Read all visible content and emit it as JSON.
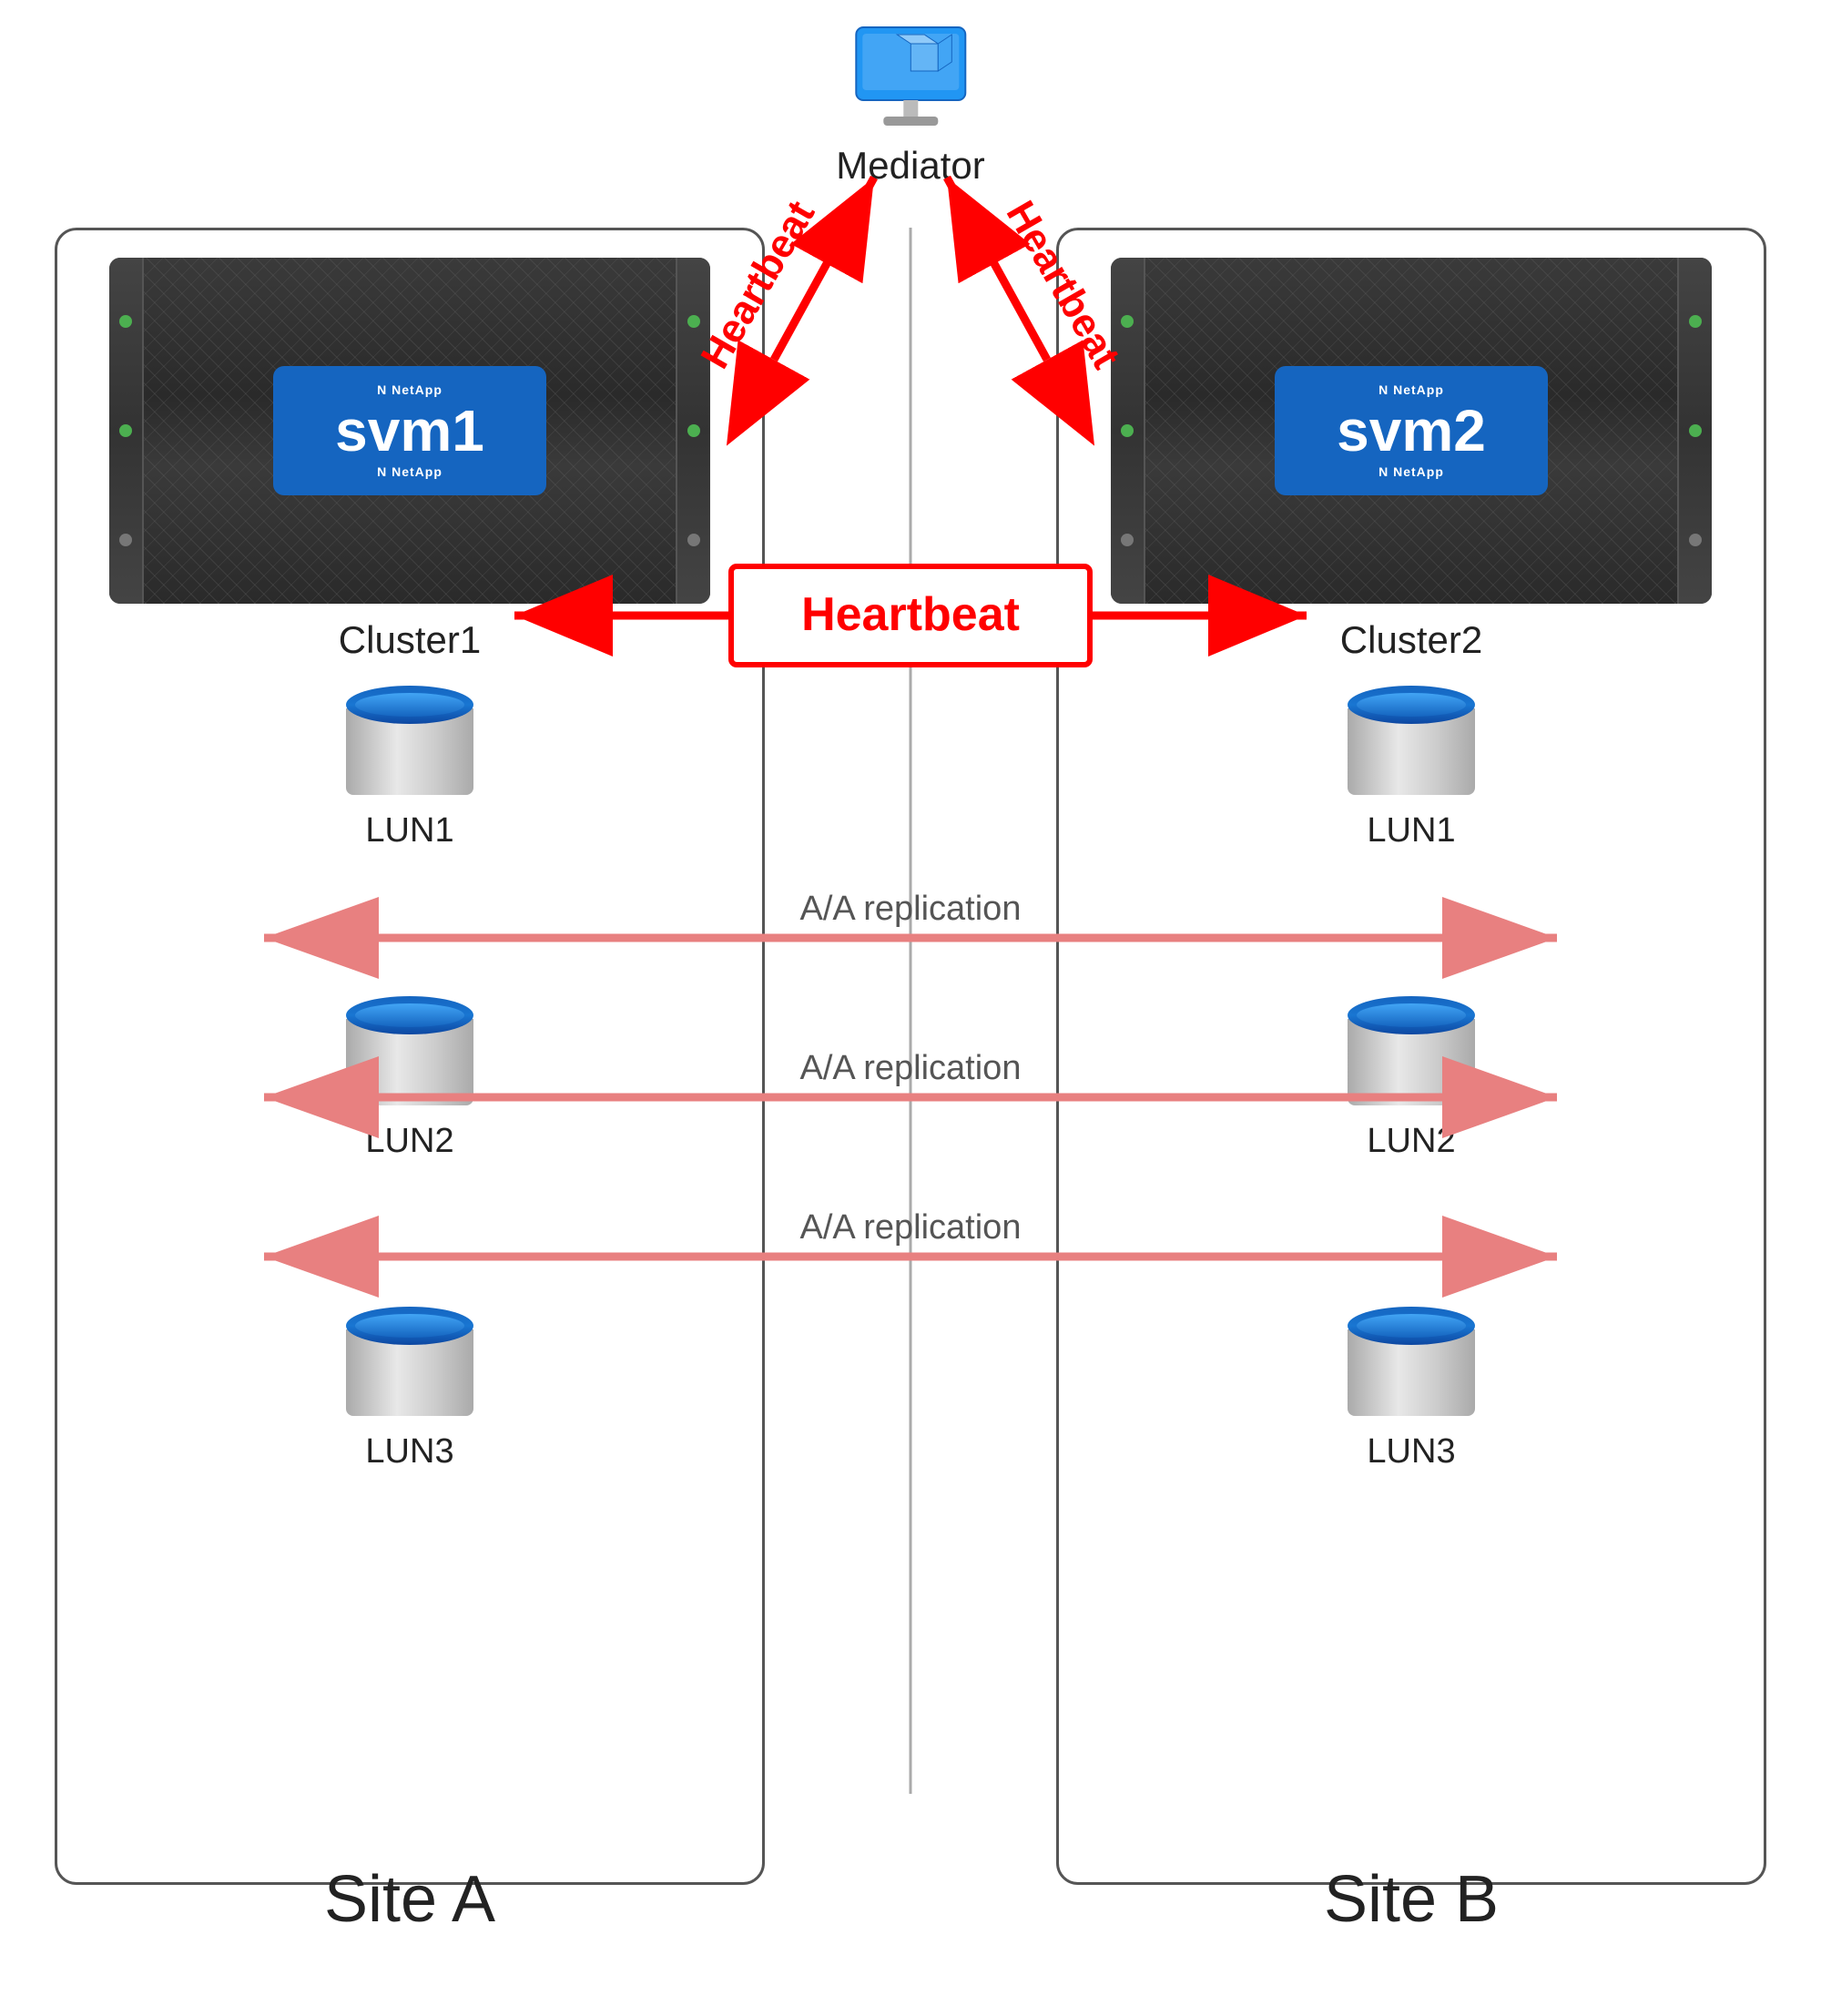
{
  "mediator": {
    "label": "Mediator"
  },
  "siteA": {
    "label": "Site A",
    "cluster": {
      "svm": "svm1",
      "name": "Cluster1"
    },
    "luns": [
      "LUN1",
      "LUN2",
      "LUN3"
    ]
  },
  "siteB": {
    "label": "Site B",
    "cluster": {
      "svm": "svm2",
      "name": "Cluster2"
    },
    "luns": [
      "LUN1",
      "LUN2",
      "LUN3"
    ]
  },
  "arrows": {
    "heartbeat": "Heartbeat",
    "replication": "A/A replication"
  },
  "colors": {
    "red": "#FF0000",
    "pink_arrow": "#E88080",
    "border": "#555555",
    "blue_server": "#1565C0"
  }
}
